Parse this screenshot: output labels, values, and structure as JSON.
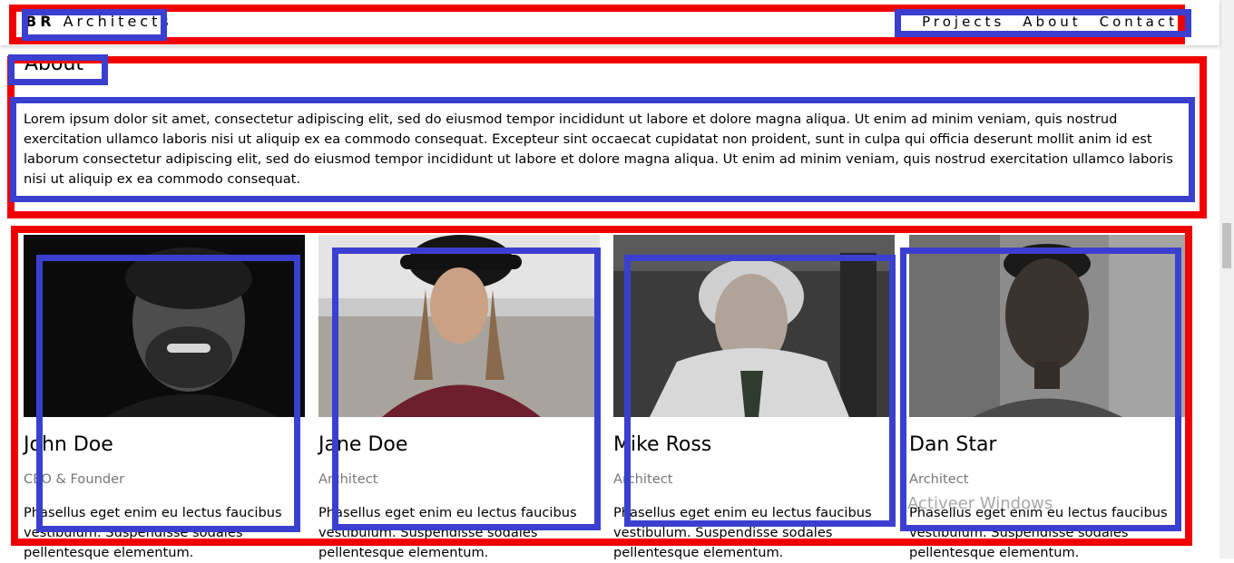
{
  "header": {
    "brand_bold": "BR",
    "brand_text": "Architects",
    "nav": [
      "Projects",
      "About",
      "Contact"
    ]
  },
  "about": {
    "title": "About",
    "text": "Lorem ipsum dolor sit amet, consectetur adipiscing elit, sed do eiusmod tempor incididunt ut labore et dolore magna aliqua. Ut enim ad minim veniam, quis nostrud exercitation ullamco laboris nisi ut aliquip ex ea commodo consequat. Excepteur sint occaecat cupidatat non proident, sunt in culpa qui officia deserunt mollit anim id est laborum consectetur adipiscing elit, sed do eiusmod tempor incididunt ut labore et dolore magna aliqua. Ut enim ad minim veniam, quis nostrud exercitation ullamco laboris nisi ut aliquip ex ea commodo consequat."
  },
  "team": [
    {
      "name": "John Doe",
      "role": "CEO & Founder",
      "desc": "Phasellus eget enim eu lectus faucibus vestibulum. Suspendisse sodales pellentesque elementum."
    },
    {
      "name": "Jane Doe",
      "role": "Architect",
      "desc": "Phasellus eget enim eu lectus faucibus vestibulum. Suspendisse sodales pellentesque elementum."
    },
    {
      "name": "Mike Ross",
      "role": "Architect",
      "desc": "Phasellus eget enim eu lectus faucibus vestibulum. Suspendisse sodales pellentesque elementum."
    },
    {
      "name": "Dan Star",
      "role": "Architect",
      "desc": "Phasellus eget enim eu lectus faucibus vestibulum. Suspendisse sodales pellentesque elementum."
    }
  ],
  "watermark": "Activeer Windows",
  "colors": {
    "annotation_red": "#f10000",
    "annotation_blue": "#3b3fd0"
  }
}
